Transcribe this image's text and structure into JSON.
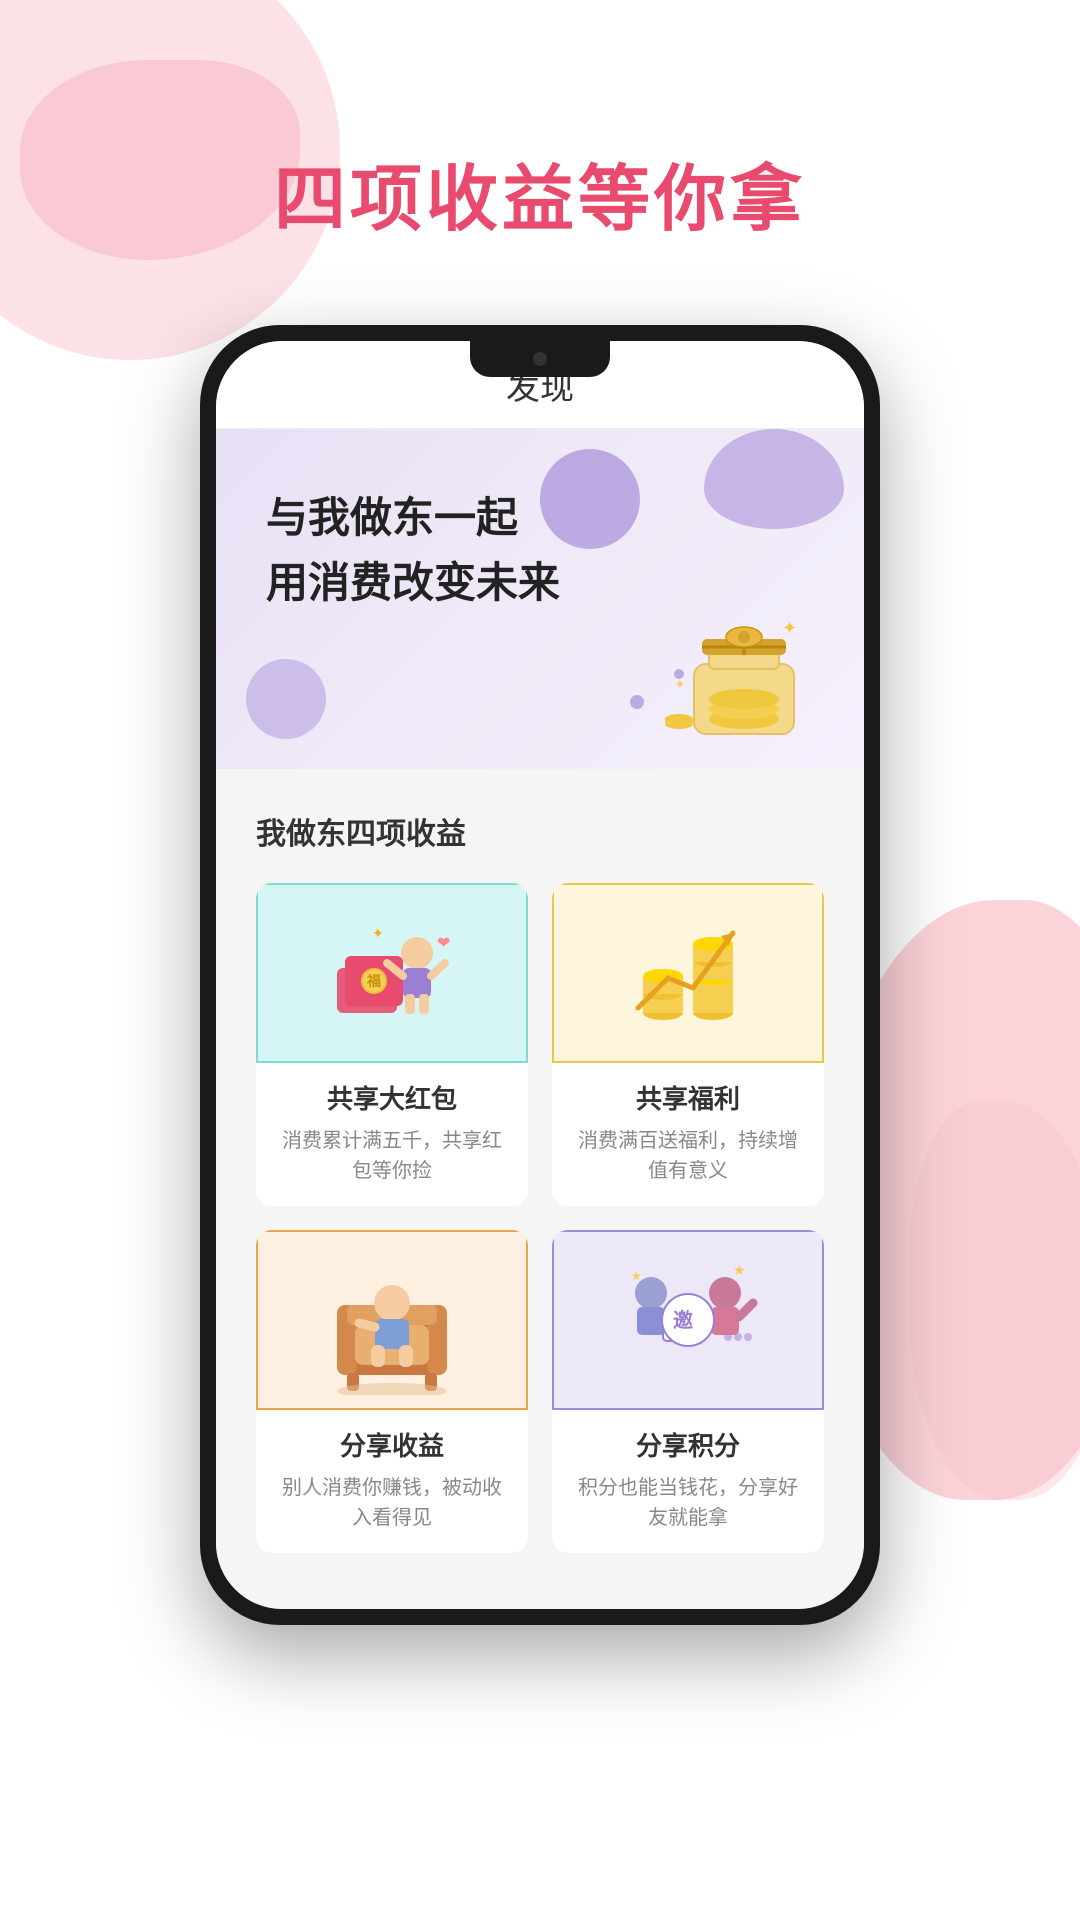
{
  "page": {
    "title": "四项收益等你拿",
    "bg_colors": {
      "primary": "#e84b6e",
      "blob1": "#f9c4ce",
      "blob2": "#f7a8b8"
    }
  },
  "phone": {
    "header": {
      "title": "发现"
    },
    "hero": {
      "line1": "与我做东一起",
      "line2": "用消费改变未来"
    },
    "benefits": {
      "section_title": "我做东四项收益",
      "cards": [
        {
          "id": "card1",
          "title": "共享大红包",
          "desc": "消费累计满五千，共享红包等你捡",
          "bg": "cyan"
        },
        {
          "id": "card2",
          "title": "共享福利",
          "desc": "消费满百送福利，持续增值有意义",
          "bg": "yellow"
        },
        {
          "id": "card3",
          "title": "分享收益",
          "desc": "别人消费你赚钱，被动收入看得见",
          "bg": "orange"
        },
        {
          "id": "card4",
          "title": "分享积分",
          "desc": "积分也能当钱花，分享好友就能拿",
          "bg": "purple"
        }
      ]
    }
  }
}
